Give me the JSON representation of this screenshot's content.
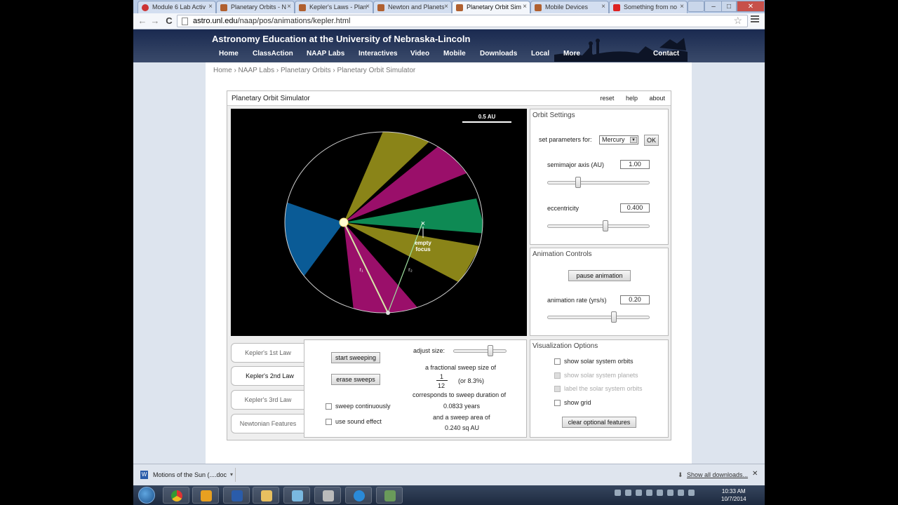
{
  "browser": {
    "tabs": [
      {
        "label": "Module 6 Lab Activ",
        "active": false
      },
      {
        "label": "Planetary Orbits - N",
        "active": false
      },
      {
        "label": "Kepler's Laws - Plan",
        "active": false
      },
      {
        "label": "Newton and Planets",
        "active": false
      },
      {
        "label": "Planetary Orbit Sim",
        "active": true
      },
      {
        "label": "Mobile Devices",
        "active": false
      },
      {
        "label": "Something from no",
        "active": false
      }
    ],
    "tab_close": "×",
    "window_controls": {
      "minimize": "–",
      "maximize": "□",
      "close": "✕"
    },
    "nav": {
      "back": "←",
      "forward": "→",
      "reload": "C"
    },
    "url_host": "astro.unl.edu",
    "url_path": "/naap/pos/animations/kepler.html",
    "bookmark_star": "☆"
  },
  "site": {
    "title": "Astronomy Education at the University of Nebraska-Lincoln",
    "nav": [
      "Home",
      "ClassAction",
      "NAAP Labs",
      "Interactives",
      "Video",
      "Mobile",
      "Downloads",
      "Local",
      "More",
      "Contact"
    ],
    "breadcrumb": "Home › NAAP Labs › Planetary Orbits › Planetary Orbit Simulator"
  },
  "app": {
    "title": "Planetary Orbit Simulator",
    "links": {
      "reset": "reset",
      "help": "help",
      "about": "about"
    },
    "canvas": {
      "scale_label": "0.5 AU",
      "empty_focus_label_1": "empty",
      "empty_focus_label_2": "focus",
      "r1_label": "r₁",
      "r2_label": "r₂",
      "x_marker": "×",
      "colors": {
        "blue": "#0a5b96",
        "olive": "#8a8418",
        "magenta": "#9a0f6a",
        "green": "#0e8a54",
        "orbit": "#cfcfcf",
        "sun": "#fffbd0"
      }
    },
    "orbit_settings": {
      "title": "Orbit Settings",
      "set_params_label": "set parameters for:",
      "planet_selected": "Mercury",
      "ok_label": "OK",
      "semimajor_label": "semimajor axis (AU)",
      "semimajor_value": "1.00",
      "semimajor_slider": 0.3,
      "eccentricity_label": "eccentricity",
      "eccentricity_value": "0.400",
      "eccentricity_slider": 0.57
    },
    "animation_controls": {
      "title": "Animation Controls",
      "pause_label": "pause animation",
      "rate_label": "animation rate (yrs/s)",
      "rate_value": "0.20",
      "rate_slider": 0.65
    },
    "visualization": {
      "title": "Visualization Options",
      "options": [
        {
          "label": "show solar system orbits",
          "checked": false,
          "disabled": false
        },
        {
          "label": "show solar system planets",
          "checked": false,
          "disabled": true
        },
        {
          "label": "label the solar system orbits",
          "checked": false,
          "disabled": true
        },
        {
          "label": "show grid",
          "checked": false,
          "disabled": false
        }
      ],
      "clear_label": "clear optional features"
    },
    "law_tabs": [
      {
        "label": "Kepler's 1st Law",
        "active": false
      },
      {
        "label": "Kepler's 2nd Law",
        "active": true
      },
      {
        "label": "Kepler's 3rd Law",
        "active": false
      },
      {
        "label": "Newtonian Features",
        "active": false
      }
    ],
    "sweep": {
      "start_label": "start sweeping",
      "erase_label": "erase sweeps",
      "continuous_label": "sweep continuously",
      "sound_label": "use sound effect",
      "adjust_label": "adjust size:",
      "adjust_slider": 0.7,
      "fraction_text": "a fractional sweep size of",
      "numerator": "1",
      "denominator": "12",
      "percent_text": "(or   8.3%)",
      "duration_text": "corresponds to sweep duration of",
      "duration_value": "0.0833 years",
      "area_text": "and a sweep area of",
      "area_value": "0.240 sq AU"
    }
  },
  "downloads": {
    "item": "Motions of the Sun (....doc",
    "item_icon": "W",
    "show_all": "Show all downloads...",
    "close": "✕"
  },
  "taskbar": {
    "time": "10:33 AM",
    "date": "10/7/2014"
  }
}
